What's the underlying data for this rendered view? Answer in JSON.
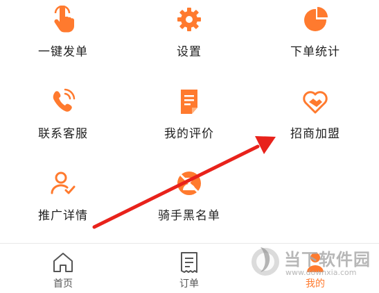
{
  "colors": {
    "accent": "#ff7a2e",
    "arrow": "#e8221b",
    "text": "#1f1f1f"
  },
  "menu": [
    {
      "label": "一键发单",
      "icon": "tap-hand-icon"
    },
    {
      "label": "设置",
      "icon": "gear-icon"
    },
    {
      "label": "下单统计",
      "icon": "pie-chart-icon"
    },
    {
      "label": "联系客服",
      "icon": "phone-icon"
    },
    {
      "label": "我的评价",
      "icon": "document-icon"
    },
    {
      "label": "招商加盟",
      "icon": "handshake-heart-icon"
    },
    {
      "label": "推广详情",
      "icon": "user-check-icon"
    },
    {
      "label": "骑手黑名单",
      "icon": "blocked-rider-icon"
    }
  ],
  "tabs": [
    {
      "label": "首页",
      "icon": "home-icon",
      "active": false
    },
    {
      "label": "订单",
      "icon": "order-list-icon",
      "active": false
    },
    {
      "label": "我的",
      "icon": "user-icon",
      "active": true
    }
  ],
  "watermark": {
    "title": "当下软件园",
    "url": "www.downxia.com",
    "icon": "downxia-logo-icon"
  }
}
